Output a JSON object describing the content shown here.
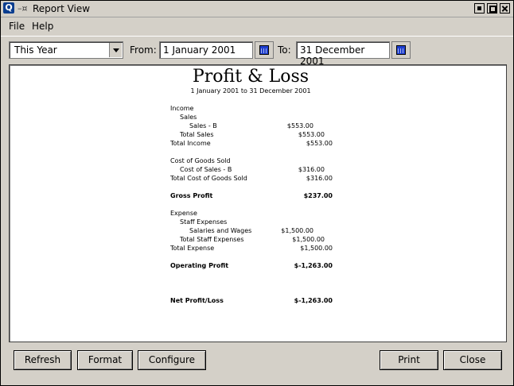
{
  "window": {
    "title": "Report View",
    "app_icon_letter": "Q"
  },
  "menu": {
    "file": "File",
    "help": "Help"
  },
  "toolbar": {
    "period": "This Year",
    "from_label": "From:",
    "from_value": "1 January 2001",
    "to_label": "To:",
    "to_value": "31 December 2001"
  },
  "report": {
    "title": "Profit & Loss",
    "subtitle": "1 January 2001 to 31 December 2001",
    "lines": [
      {
        "label": "Income",
        "indent": 0,
        "amount": "",
        "col": 0,
        "bold": false
      },
      {
        "label": "Sales",
        "indent": 1,
        "amount": "",
        "col": 0,
        "bold": false
      },
      {
        "label": "Sales - B",
        "indent": 2,
        "amount": "$553.00",
        "col": 1,
        "bold": false
      },
      {
        "label": "Total Sales",
        "indent": 1,
        "amount": "$553.00",
        "col": 2,
        "bold": false
      },
      {
        "label": "Total Income",
        "indent": 0,
        "amount": "$553.00",
        "col": 3,
        "bold": false
      },
      {
        "label": "Cost of Goods Sold",
        "indent": 0,
        "amount": "",
        "col": 0,
        "bold": false,
        "gap": true
      },
      {
        "label": "Cost of Sales - B",
        "indent": 1,
        "amount": "$316.00",
        "col": 2,
        "bold": false
      },
      {
        "label": "Total Cost of Goods Sold",
        "indent": 0,
        "amount": "$316.00",
        "col": 3,
        "bold": false
      },
      {
        "label": "Gross Profit",
        "indent": 0,
        "amount": "$237.00",
        "col": 3,
        "bold": true,
        "gap": true
      },
      {
        "label": "Expense",
        "indent": 0,
        "amount": "",
        "col": 0,
        "bold": false,
        "gap": true
      },
      {
        "label": "Staff Expenses",
        "indent": 1,
        "amount": "",
        "col": 0,
        "bold": false
      },
      {
        "label": "Salaries and Wages",
        "indent": 2,
        "amount": "$1,500.00",
        "col": 1,
        "bold": false
      },
      {
        "label": "Total Staff Expenses",
        "indent": 1,
        "amount": "$1,500.00",
        "col": 2,
        "bold": false
      },
      {
        "label": "Total Expense",
        "indent": 0,
        "amount": "$1,500.00",
        "col": 3,
        "bold": false
      },
      {
        "label": "Operating Profit",
        "indent": 0,
        "amount": "$-1,263.00",
        "col": 3,
        "bold": true,
        "gap": true
      },
      {
        "label": "Net Profit/Loss",
        "indent": 0,
        "amount": "$-1,263.00",
        "col": 3,
        "bold": true,
        "gap": true,
        "biggap": true
      }
    ]
  },
  "buttons": {
    "refresh": "Refresh",
    "format": "Format",
    "configure": "Configure",
    "print": "Print",
    "close": "Close"
  }
}
